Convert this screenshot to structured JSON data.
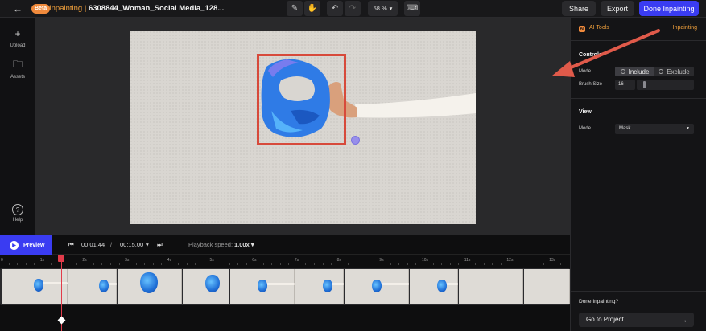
{
  "header": {
    "beta_badge": "Beta",
    "mode_label": "Inpainting",
    "separator": "|",
    "file_name": "6308844_Woman_Social Media_128...",
    "zoom": "58 %",
    "share_label": "Share",
    "export_label": "Export",
    "done_label": "Done Inpainting"
  },
  "sidebar": {
    "items": [
      {
        "label": "Upload",
        "icon": "plus-icon"
      },
      {
        "label": "Assets",
        "icon": "folder-icon"
      },
      {
        "label": "Help",
        "icon": "help-icon"
      }
    ]
  },
  "panel": {
    "ai_tools_label": "AI Tools",
    "active_tool": "Inpainting",
    "controls_title": "Controls",
    "mode_label": "Mode",
    "mode_options": [
      "Include",
      "Exclude"
    ],
    "mode_selected": "Include",
    "brush_size_label": "Brush Size",
    "brush_size_value": "16",
    "view_title": "View",
    "view_mode_label": "Mode",
    "view_mode_value": "Mask",
    "done_question": "Done Inpainting?",
    "go_to_project": "Go to Project"
  },
  "timeline": {
    "preview_label": "Preview",
    "current_time": "00:01.44",
    "time_separator": "/",
    "total_time": "00:15.00",
    "playback_speed_label": "Playback speed:",
    "playback_speed_value": "1.00x",
    "ruler": [
      "0",
      "1s",
      "2s",
      "3s",
      "4s",
      "5s",
      "6s",
      "7s",
      "8s",
      "9s",
      "10s",
      "11s",
      "12s",
      "13s"
    ]
  },
  "colors": {
    "accent": "#3a3cf2",
    "orange": "#f08a3c",
    "selection_box": "#d74a3b",
    "playhead": "#e23b4a"
  }
}
